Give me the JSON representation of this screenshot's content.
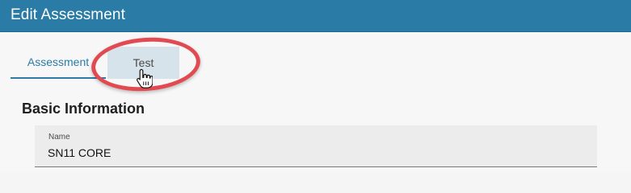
{
  "header": {
    "title": "Edit Assessment"
  },
  "tabs": [
    {
      "label": "Assessment",
      "state": "active"
    },
    {
      "label": "Test",
      "state": "hover"
    }
  ],
  "section": {
    "title": "Basic Information"
  },
  "fields": [
    {
      "label": "Name",
      "value": "SN11 CORE"
    }
  ],
  "annotation": {
    "ring_color": "#e24a52",
    "cursor_icon": "hand-pointer-icon"
  },
  "colors": {
    "header": "#2a7ba6",
    "accent": "#2a7ba6",
    "hover_tab": "#d7e3ea"
  }
}
